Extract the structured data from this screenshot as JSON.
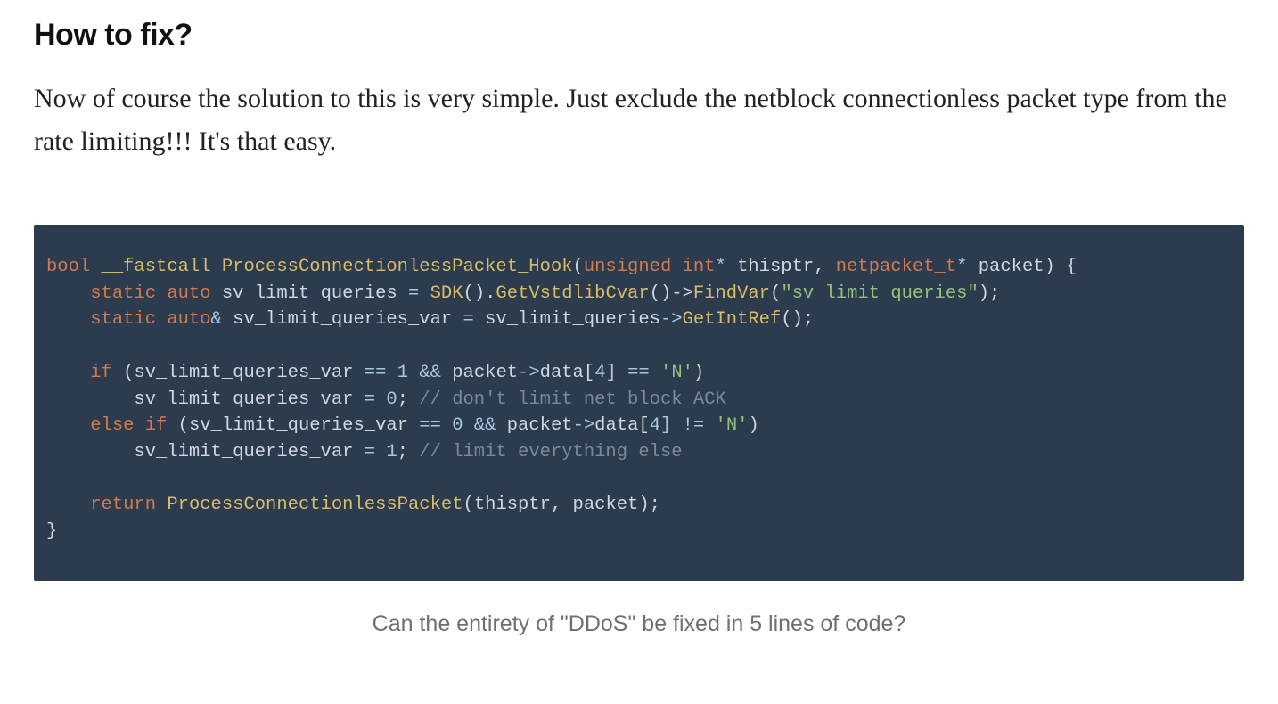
{
  "article": {
    "heading": "How to fix?",
    "paragraph": "Now of course the solution to this is very simple. Just exclude the netblock connectionless packet type from the rate limiting!!! It's that easy.",
    "caption": "Can the entirety of \"DDoS\" be fixed in 5 lines of code?"
  },
  "code": {
    "t01": "bool",
    "t02": " __fastcall ",
    "t03": "ProcessConnectionlessPacket_Hook",
    "t04": "(",
    "t05": "unsigned int",
    "t06": "* ",
    "t07": "thisptr",
    "t08": ", ",
    "t09": "netpacket_t",
    "t10": "* ",
    "t11": "packet",
    "t12": ") {",
    "nl1": "\n    ",
    "t13": "static auto",
    "t14": " ",
    "t15": "sv_limit_queries",
    "t16": " = ",
    "t17": "SDK",
    "t18": "().",
    "t19": "GetVstdlibCvar",
    "t20": "()->",
    "t21": "FindVar",
    "t22": "(",
    "t23": "\"sv_limit_queries\"",
    "t24": ");",
    "nl2": "\n    ",
    "t25": "static auto",
    "t26": "& ",
    "t27": "sv_limit_queries_var",
    "t28": " = ",
    "t29": "sv_limit_queries",
    "t30": "->",
    "t31": "GetIntRef",
    "t32": "();",
    "nl3": "\n\n    ",
    "t33": "if",
    "t34": " (",
    "t35": "sv_limit_queries_var",
    "t36": " == ",
    "t37": "1",
    "t38": " && ",
    "t39": "packet",
    "t40": "->",
    "t41": "data",
    "t42": "[",
    "t43": "4",
    "t44": "] == ",
    "t45": "'N'",
    "t46": ")",
    "nl4": "\n        ",
    "t47": "sv_limit_queries_var",
    "t48": " = ",
    "t49": "0",
    "t50": "; ",
    "t51": "// don't limit net block ACK",
    "nl5": "\n    ",
    "t52": "else if",
    "t53": " (",
    "t54": "sv_limit_queries_var",
    "t55": " == ",
    "t56": "0",
    "t57": " && ",
    "t58": "packet",
    "t59": "->",
    "t60": "data",
    "t61": "[",
    "t62": "4",
    "t63": "] != ",
    "t64": "'N'",
    "t65": ")",
    "nl6": "\n        ",
    "t66": "sv_limit_queries_var",
    "t67": " = ",
    "t68": "1",
    "t69": "; ",
    "t70": "// limit everything else",
    "nl7": "\n\n    ",
    "t71": "return",
    "t72": " ",
    "t73": "ProcessConnectionlessPacket",
    "t74": "(",
    "t75": "thisptr",
    "t76": ", ",
    "t77": "packet",
    "t78": ");",
    "nl8": "\n",
    "t79": "}"
  }
}
